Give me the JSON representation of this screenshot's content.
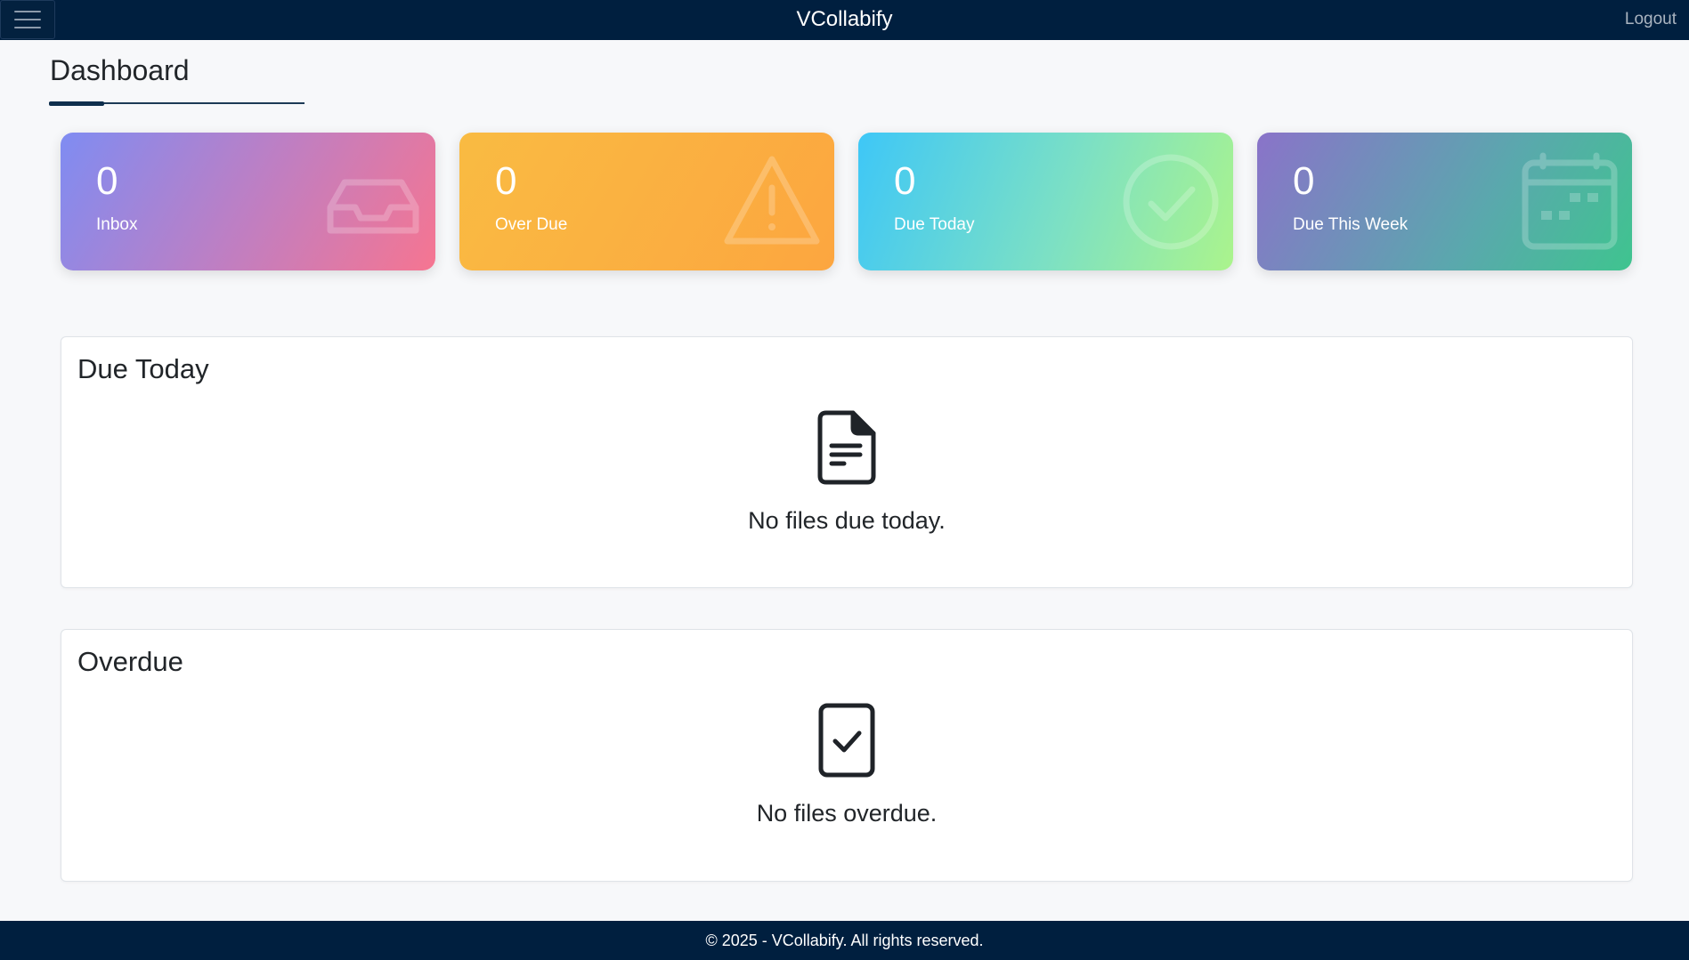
{
  "header": {
    "brand": "VCollabify",
    "logout_label": "Logout",
    "menu_icon": "hamburger-menu-icon"
  },
  "page": {
    "title": "Dashboard"
  },
  "stats": [
    {
      "count": "0",
      "label": "Inbox",
      "icon": "inbox-tray-icon",
      "colors": [
        "#7f8cf2",
        "#f67591"
      ]
    },
    {
      "count": "0",
      "label": "Over Due",
      "icon": "warning-triangle-icon",
      "colors": [
        "#f9bb42",
        "#fca640"
      ]
    },
    {
      "count": "0",
      "label": "Due Today",
      "icon": "check-circle-icon",
      "colors": [
        "#3ec7f7",
        "#abf48c"
      ]
    },
    {
      "count": "0",
      "label": "Due This Week",
      "icon": "calendar-icon",
      "colors": [
        "#8a73c9",
        "#3fc48f"
      ]
    }
  ],
  "panels": {
    "due_today": {
      "title": "Due Today",
      "empty_message": "No files due today.",
      "icon": "document-text-icon"
    },
    "overdue": {
      "title": "Overdue",
      "empty_message": "No files overdue.",
      "icon": "clipboard-check-icon"
    }
  },
  "footer": {
    "text": "© 2025 - VCollabify. All rights reserved."
  },
  "colors": {
    "navbar": "#001f3f",
    "background": "#f7f8fa"
  }
}
